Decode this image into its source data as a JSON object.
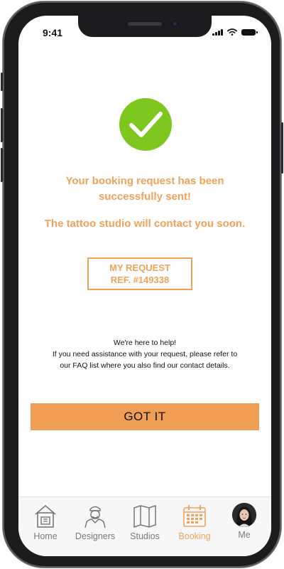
{
  "status_bar": {
    "time": "9:41"
  },
  "confirmation": {
    "line1": "Your booking request has been",
    "line2": "successfully sent!",
    "contact": "The tattoo studio will contact you soon.",
    "ref_line1": "MY REQUEST",
    "ref_line2": "REF. #149338"
  },
  "help": {
    "line1": "We're here to help!",
    "line2": "If you need assistance with your request, please refer to",
    "line3": "our FAQ list where you also find our contact details."
  },
  "primary_button": {
    "label": "GOT IT"
  },
  "tabs": [
    {
      "label": "Home",
      "icon": "house-icon",
      "active": false
    },
    {
      "label": "Designers",
      "icon": "designer-icon",
      "active": false
    },
    {
      "label": "Studios",
      "icon": "map-icon",
      "active": false
    },
    {
      "label": "Booking",
      "icon": "calendar-icon",
      "active": true
    },
    {
      "label": "Me",
      "icon": "avatar",
      "active": false
    }
  ],
  "colors": {
    "accent": "#f2a25a",
    "success": "#7dc71f",
    "button": "#f19e55"
  }
}
